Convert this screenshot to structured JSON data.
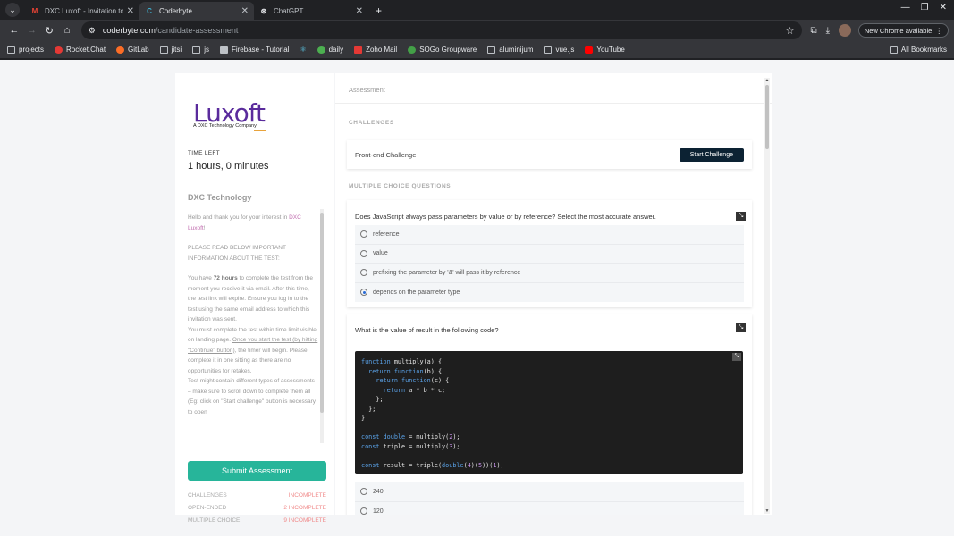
{
  "browser": {
    "tabs": [
      {
        "title": "DXC Luxoft - Invitation to C",
        "icon": "gmail-icon",
        "active": false
      },
      {
        "title": "Coderbyte",
        "icon": "coderbyte-icon",
        "active": true
      },
      {
        "title": "ChatGPT",
        "icon": "chatgpt-icon",
        "active": false
      }
    ],
    "new_tab": "+",
    "url_host": "coderbyte.com",
    "url_path": "/candidate-assessment",
    "new_chrome_label": "New Chrome available",
    "bookmarks": [
      "projects",
      "Rocket.Chat",
      "GitLab",
      "jitsi",
      "js",
      "Firebase - Tutorial",
      "",
      "daily",
      "Zoho Mail",
      "SOGo Groupware",
      "aluminijum",
      "vue.js",
      "YouTube"
    ],
    "all_bookmarks": "All Bookmarks"
  },
  "sidebar": {
    "logo_text": "Luxoft",
    "logo_sub": "A DXC Technology Company",
    "time_label": "TIME LEFT",
    "time_value": "1 hours, 0 minutes",
    "org_name": "DXC Technology",
    "intro_prefix": "Hello and thank you for your interest in ",
    "intro_company": "DXC Luxoft",
    "intro_suffix": "!",
    "notice": "PLEASE READ BELOW IMPORTANT INFORMATION ABOUT THE TEST:",
    "p1_a": "You have ",
    "p1_hours": "72 hours",
    "p1_b": " to complete the test from the moment you receive it via email. After this time, the test link will expire. Ensure you log in to the test using the same email address to which this invitation was sent.",
    "p2_a": "You must complete the test within time limit visible on landing page. ",
    "p2_u": "Once you start the test (by hitting \"Continue\" button)",
    "p2_b": ", the timer will begin. Please complete it in one sitting as there are no opportunities for retakes.",
    "p3": "Test might contain different types of assessments – make sure to scroll down to complete them all (Eg: click on \"Start challenge\" button is necessary to open",
    "submit_label": "Submit Assessment",
    "stats": [
      {
        "label": "CHALLENGES",
        "value": "INCOMPLETE"
      },
      {
        "label": "OPEN-ENDED",
        "value": "2 INCOMPLETE"
      },
      {
        "label": "MULTIPLE CHOICE",
        "value": "9 INCOMPLETE"
      }
    ]
  },
  "main": {
    "header": "Assessment",
    "challenges_heading": "CHALLENGES",
    "challenge_name": "Front-end Challenge",
    "start_label": "Start Challenge",
    "mcq_heading": "MULTIPLE CHOICE QUESTIONS",
    "q1": {
      "text": "Does JavaScript always pass parameters by value or by reference? Select the most accurate answer.",
      "options": [
        "reference",
        "value",
        "prefixing the parameter by '&' will pass it by reference",
        "depends on the parameter type"
      ],
      "selected_index": 3
    },
    "q2": {
      "text": "What is the value of result in the following code?",
      "code": {
        "l1a": "function",
        "l1b": " multiply(a) {",
        "l2a": "  return ",
        "l2b": "function",
        "l2c": "(b) {",
        "l3a": "    return ",
        "l3b": "function",
        "l3c": "(c) {",
        "l4a": "      return",
        "l4b": " a * b * c;",
        "l5": "    };",
        "l6": "  };",
        "l7": "}",
        "l8a": "const",
        "l8b": " double",
        "l8c": " = multiply(",
        "l8d": "2",
        "l8e": ");",
        "l9a": "const",
        "l9b": " triple = multiply(",
        "l9c": "3",
        "l9d": ");",
        "l10a": "const",
        "l10b": " result = triple(",
        "l10c": "double",
        "l10d": "(",
        "l10e": "4",
        "l10f": ")(",
        "l10g": "5",
        "l10h": "))(",
        "l10i": "1",
        "l10j": ");"
      },
      "options": [
        "240",
        "120"
      ]
    }
  },
  "colors": {
    "accent": "#27b59a",
    "brand": "#5a2b9c",
    "incomplete": "#f08b8b",
    "start_button": "#0c2233"
  }
}
